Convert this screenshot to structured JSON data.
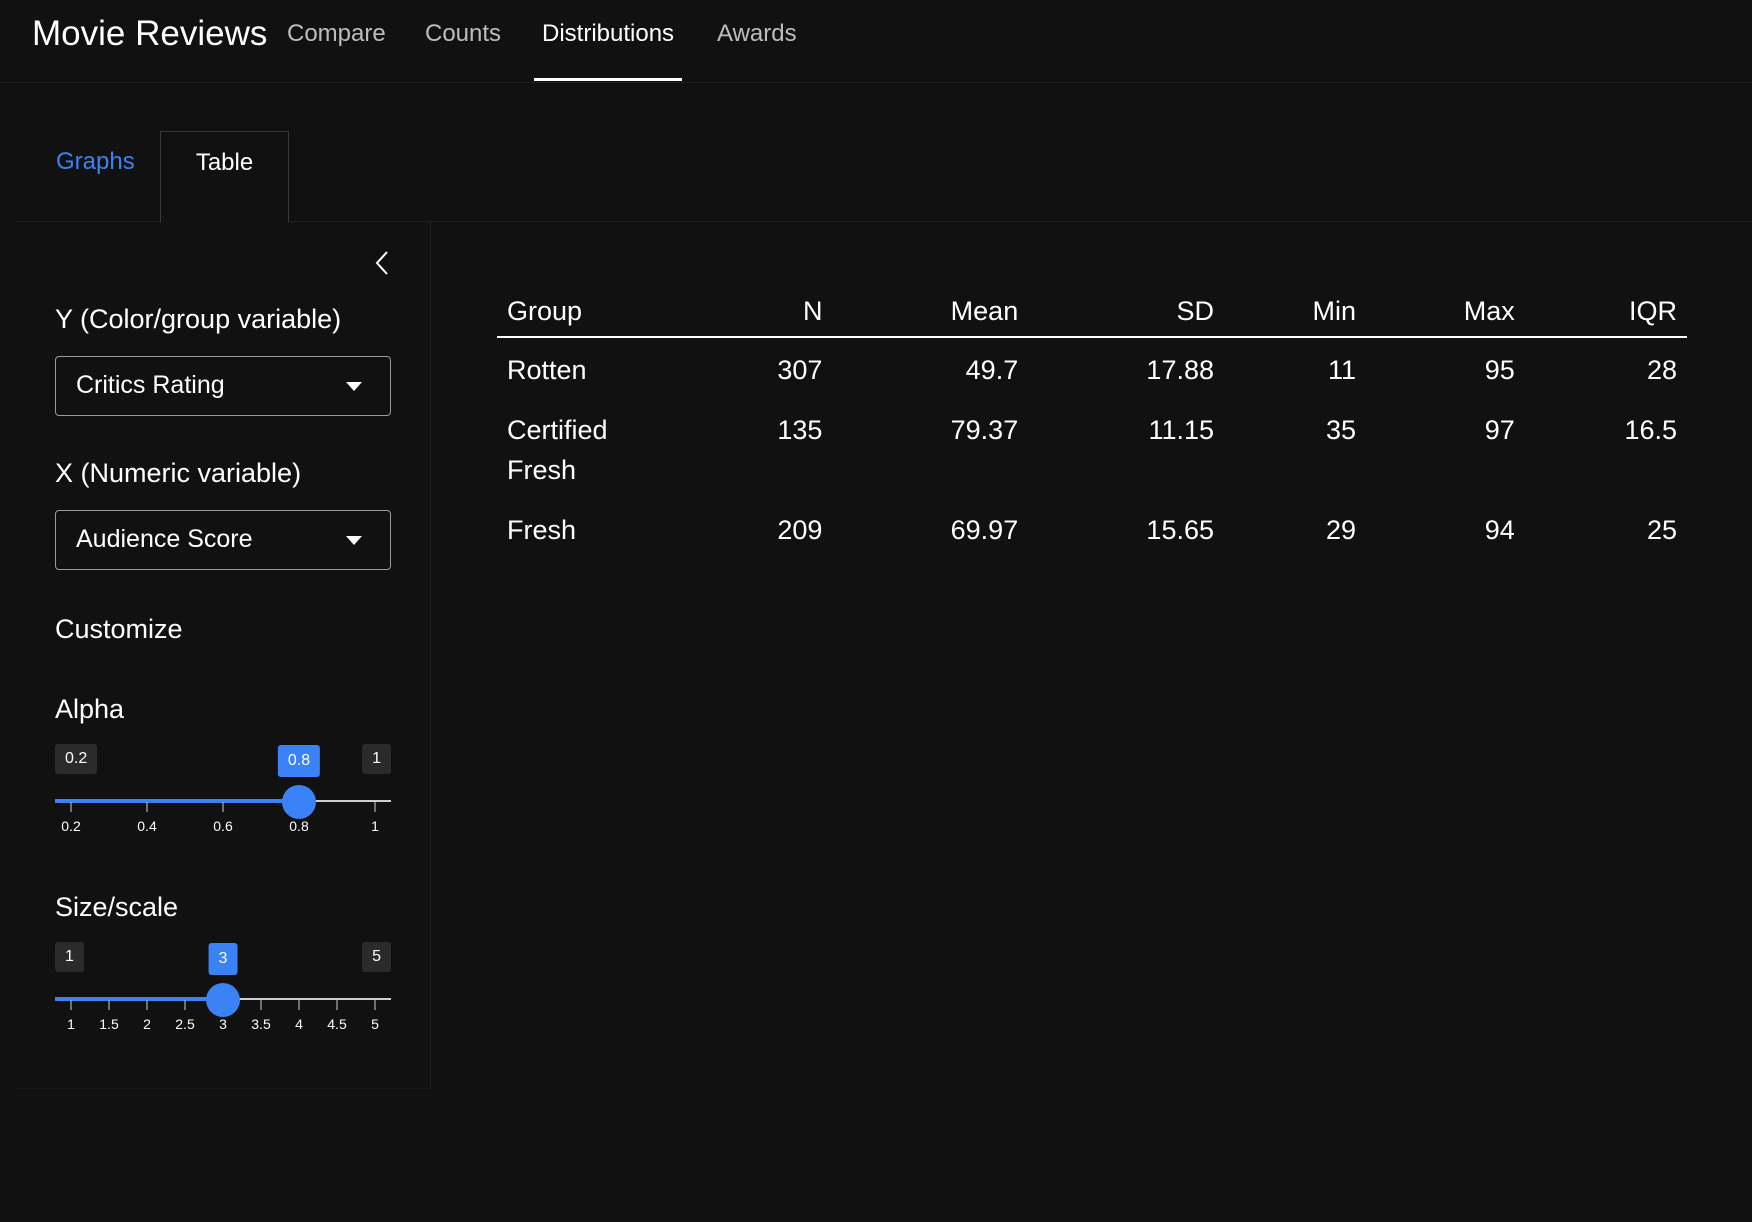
{
  "app": {
    "title": "Movie Reviews"
  },
  "nav": {
    "items": [
      {
        "label": "Compare"
      },
      {
        "label": "Counts"
      },
      {
        "label": "Distributions"
      },
      {
        "label": "Awards"
      }
    ],
    "active": "Distributions"
  },
  "subtabs": [
    {
      "label": "Graphs"
    },
    {
      "label": "Table"
    }
  ],
  "active_subtab": "Table",
  "sidebar": {
    "y_label": "Y (Color/group variable)",
    "y_value": "Critics Rating",
    "x_label": "X (Numeric variable)",
    "x_value": "Audience Score",
    "customize_title": "Customize",
    "alpha": {
      "label": "Alpha",
      "min": 0.2,
      "max": 1,
      "value": 0.8,
      "min_label": "0.2",
      "max_label": "1",
      "value_label": "0.8",
      "ticks": [
        "0.2",
        "0.4",
        "0.6",
        "0.8",
        "1"
      ]
    },
    "size": {
      "label": "Size/scale",
      "min": 1,
      "max": 5,
      "value": 3,
      "min_label": "1",
      "max_label": "5",
      "value_label": "3",
      "ticks": [
        "1",
        "1.5",
        "2",
        "2.5",
        "3",
        "3.5",
        "4",
        "4.5",
        "5"
      ]
    }
  },
  "table": {
    "headers": [
      "Group",
      "N",
      "Mean",
      "SD",
      "Min",
      "Max",
      "IQR"
    ],
    "rows": [
      [
        "Rotten",
        "307",
        "49.7",
        "17.88",
        "11",
        "95",
        "28"
      ],
      [
        "Certified Fresh",
        "135",
        "79.37",
        "11.15",
        "35",
        "97",
        "16.5"
      ],
      [
        "Fresh",
        "209",
        "69.97",
        "15.65",
        "29",
        "94",
        "25"
      ]
    ]
  },
  "colors": {
    "accent": "#3b82f6",
    "background": "#111111",
    "text": "#ffffff"
  }
}
